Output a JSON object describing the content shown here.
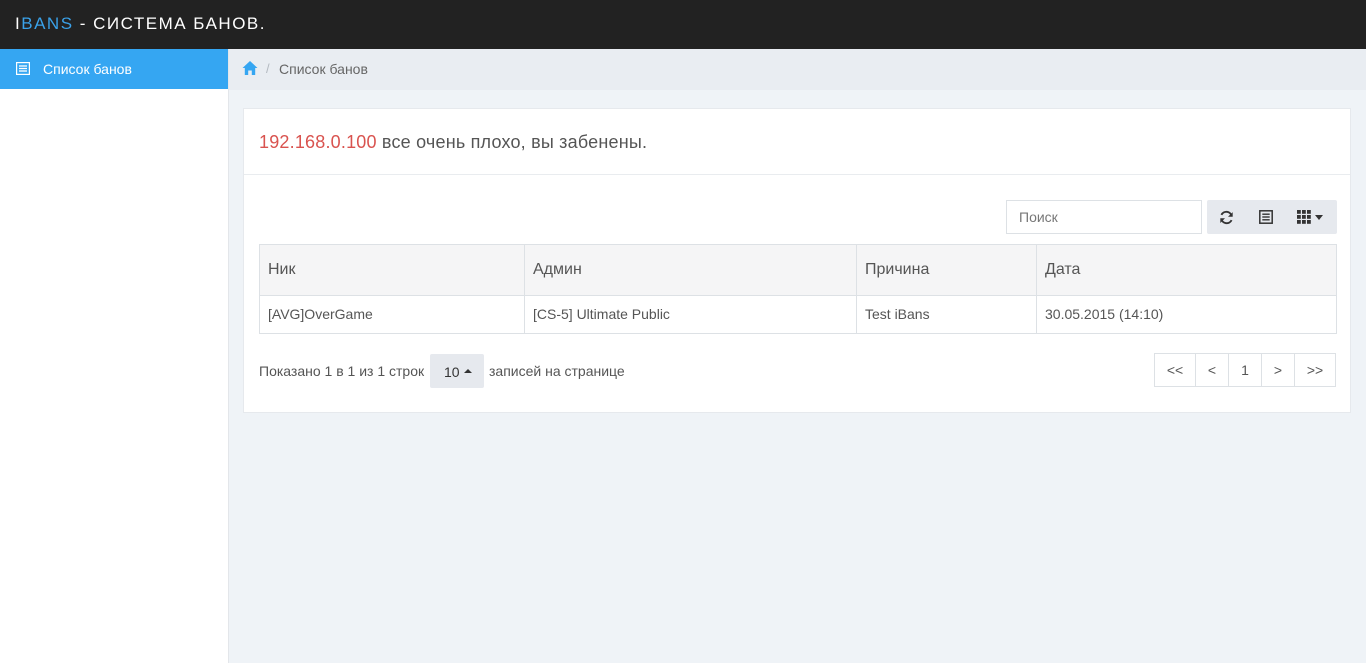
{
  "app": {
    "brand_i": "I",
    "brand_bans": "BANS",
    "brand_rest": " - СИСТЕМА БАНОВ."
  },
  "sidebar": {
    "items": [
      {
        "label": "Список банов",
        "icon": "list-icon",
        "active": true
      }
    ]
  },
  "breadcrumb": {
    "home_icon": "home-icon",
    "separator": "/",
    "current": "Список банов"
  },
  "notice": {
    "ip": "192.168.0.100",
    "text": " все очень плохо, вы забенены."
  },
  "toolbar": {
    "search_placeholder": "Поиск",
    "buttons": [
      "refresh-icon",
      "toggle-view-icon",
      "columns-icon"
    ]
  },
  "table": {
    "columns": [
      "Ник",
      "Админ",
      "Причина",
      "Дата"
    ],
    "rows": [
      [
        "[AVG]OverGame",
        "[CS-5] Ultimate Public",
        "Test iBans",
        "30.05.2015 (14:10)"
      ]
    ]
  },
  "pagination": {
    "info": "Показано 1 в 1 из 1 строк",
    "page_size": "10",
    "after": "записей на странице",
    "buttons": [
      "<<",
      "<",
      "1",
      ">",
      ">>"
    ]
  },
  "colors": {
    "accent": "#35a6f2",
    "topbar": "#222222",
    "ip_red": "#d9534f"
  }
}
